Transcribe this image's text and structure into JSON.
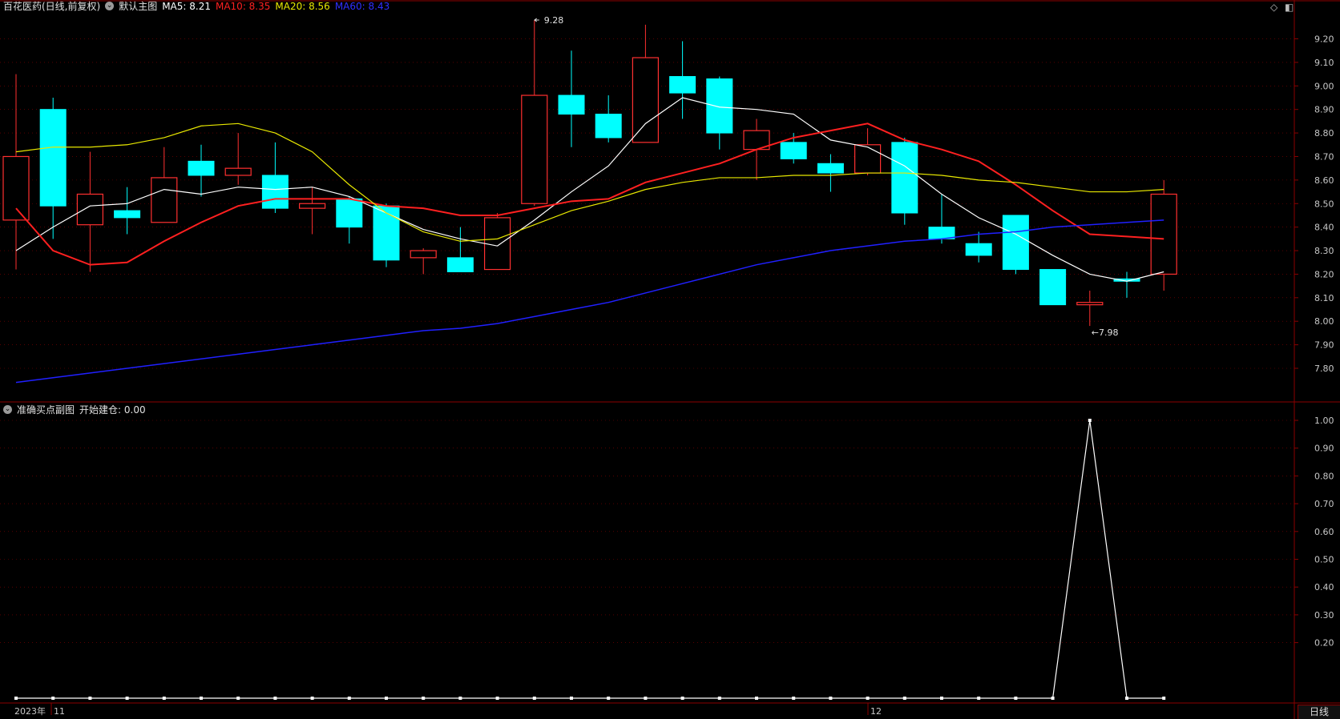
{
  "main_header": {
    "stock_name": "百花医药(日线,前复权)",
    "indicator_name": "默认主图",
    "ma5_label": "MA5: 8.21",
    "ma10_label": "MA10: 8.35",
    "ma20_label": "MA20: 8.56",
    "ma60_label": "MA60: 8.43"
  },
  "sub_header": {
    "indicator_name": "准确买点副图",
    "value_label": "开始建仓: 0.00"
  },
  "colors": {
    "up": "#ff3030",
    "down": "#00ffff",
    "ma5": "#ffffff",
    "ma10": "#ff2020",
    "ma20": "#e8e800",
    "ma60": "#2020ff",
    "grid": "#8b0000",
    "axis_text": "#c8c8c8"
  },
  "annotations": {
    "high_label": "9.28",
    "low_label": "7.98"
  },
  "x_axis": {
    "year_label": "2023年",
    "month_labels": [
      "11",
      "12"
    ]
  },
  "period_tab": "日线",
  "window_icons": [
    "diamond-icon",
    "panel-icon"
  ],
  "chart_data": [
    {
      "type": "candlestick",
      "title": "百花医药(日线,前复权)",
      "ylim": [
        7.7,
        9.28
      ],
      "y_ticks": [
        7.8,
        7.9,
        8.0,
        8.1,
        8.2,
        8.3,
        8.4,
        8.5,
        8.6,
        8.7,
        8.8,
        8.9,
        9.0,
        9.1,
        9.2
      ],
      "candles": [
        {
          "o": 8.43,
          "h": 9.05,
          "l": 8.22,
          "c": 8.7
        },
        {
          "o": 8.9,
          "h": 8.95,
          "l": 8.35,
          "c": 8.49
        },
        {
          "o": 8.41,
          "h": 8.72,
          "l": 8.21,
          "c": 8.54
        },
        {
          "o": 8.47,
          "h": 8.57,
          "l": 8.37,
          "c": 8.44
        },
        {
          "o": 8.42,
          "h": 8.74,
          "l": 8.42,
          "c": 8.61
        },
        {
          "o": 8.68,
          "h": 8.75,
          "l": 8.53,
          "c": 8.62
        },
        {
          "o": 8.62,
          "h": 8.8,
          "l": 8.58,
          "c": 8.65
        },
        {
          "o": 8.62,
          "h": 8.76,
          "l": 8.46,
          "c": 8.48
        },
        {
          "o": 8.48,
          "h": 8.57,
          "l": 8.37,
          "c": 8.5
        },
        {
          "o": 8.52,
          "h": 8.53,
          "l": 8.33,
          "c": 8.4
        },
        {
          "o": 8.49,
          "h": 8.5,
          "l": 8.23,
          "c": 8.26
        },
        {
          "o": 8.27,
          "h": 8.31,
          "l": 8.2,
          "c": 8.3
        },
        {
          "o": 8.27,
          "h": 8.4,
          "l": 8.21,
          "c": 8.21
        },
        {
          "o": 8.22,
          "h": 8.46,
          "l": 8.22,
          "c": 8.44
        },
        {
          "o": 8.5,
          "h": 9.28,
          "l": 8.49,
          "c": 8.96
        },
        {
          "o": 8.96,
          "h": 9.15,
          "l": 8.74,
          "c": 8.88
        },
        {
          "o": 8.88,
          "h": 8.96,
          "l": 8.76,
          "c": 8.78
        },
        {
          "o": 8.76,
          "h": 9.26,
          "l": 8.76,
          "c": 9.12
        },
        {
          "o": 9.04,
          "h": 9.19,
          "l": 8.86,
          "c": 8.97
        },
        {
          "o": 9.03,
          "h": 9.04,
          "l": 8.73,
          "c": 8.8
        },
        {
          "o": 8.73,
          "h": 8.86,
          "l": 8.6,
          "c": 8.81
        },
        {
          "o": 8.76,
          "h": 8.8,
          "l": 8.67,
          "c": 8.69
        },
        {
          "o": 8.67,
          "h": 8.71,
          "l": 8.55,
          "c": 8.63
        },
        {
          "o": 8.63,
          "h": 8.82,
          "l": 8.62,
          "c": 8.75
        },
        {
          "o": 8.76,
          "h": 8.78,
          "l": 8.41,
          "c": 8.46
        },
        {
          "o": 8.4,
          "h": 8.54,
          "l": 8.33,
          "c": 8.35
        },
        {
          "o": 8.33,
          "h": 8.38,
          "l": 8.25,
          "c": 8.28
        },
        {
          "o": 8.45,
          "h": 8.45,
          "l": 8.2,
          "c": 8.22
        },
        {
          "o": 8.22,
          "h": 8.22,
          "l": 8.07,
          "c": 8.07
        },
        {
          "o": 8.07,
          "h": 8.13,
          "l": 7.98,
          "c": 8.08
        },
        {
          "o": 8.18,
          "h": 8.21,
          "l": 8.1,
          "c": 8.17
        },
        {
          "o": 8.2,
          "h": 8.6,
          "l": 8.13,
          "c": 8.54
        }
      ],
      "series": [
        {
          "name": "MA5",
          "values": [
            8.3,
            8.4,
            8.49,
            8.5,
            8.56,
            8.54,
            8.57,
            8.56,
            8.57,
            8.53,
            8.46,
            8.39,
            8.35,
            8.32,
            8.43,
            8.55,
            8.66,
            8.84,
            8.95,
            8.91,
            8.9,
            8.88,
            8.77,
            8.74,
            8.66,
            8.54,
            8.44,
            8.37,
            8.28,
            8.2,
            8.17,
            8.21
          ]
        },
        {
          "name": "MA10",
          "values": [
            8.48,
            8.3,
            8.24,
            8.25,
            8.34,
            8.42,
            8.49,
            8.52,
            8.52,
            8.52,
            8.49,
            8.48,
            8.45,
            8.45,
            8.48,
            8.51,
            8.52,
            8.59,
            8.63,
            8.67,
            8.73,
            8.78,
            8.81,
            8.84,
            8.77,
            8.73,
            8.68,
            8.58,
            8.47,
            8.37,
            8.36,
            8.35
          ]
        },
        {
          "name": "MA20",
          "values": [
            8.72,
            8.74,
            8.74,
            8.75,
            8.78,
            8.83,
            8.84,
            8.8,
            8.72,
            8.58,
            8.46,
            8.38,
            8.34,
            8.35,
            8.41,
            8.47,
            8.51,
            8.56,
            8.59,
            8.61,
            8.61,
            8.62,
            8.62,
            8.63,
            8.63,
            8.62,
            8.6,
            8.59,
            8.57,
            8.55,
            8.55,
            8.56
          ]
        },
        {
          "name": "MA60",
          "values": [
            7.74,
            7.76,
            7.78,
            7.8,
            7.82,
            7.84,
            7.86,
            7.88,
            7.9,
            7.92,
            7.94,
            7.96,
            7.97,
            7.99,
            8.02,
            8.05,
            8.08,
            8.12,
            8.16,
            8.2,
            8.24,
            8.27,
            8.3,
            8.32,
            8.34,
            8.35,
            8.37,
            8.38,
            8.4,
            8.41,
            8.42,
            8.43
          ]
        }
      ]
    },
    {
      "type": "line",
      "title": "准确买点副图",
      "ylim": [
        0.0,
        1.05
      ],
      "y_ticks": [
        0.2,
        0.3,
        0.4,
        0.5,
        0.6,
        0.7,
        0.8,
        0.9,
        1.0
      ],
      "series": [
        {
          "name": "开始建仓",
          "values": [
            0,
            0,
            0,
            0,
            0,
            0,
            0,
            0,
            0,
            0,
            0,
            0,
            0,
            0,
            0,
            0,
            0,
            0,
            0,
            0,
            0,
            0,
            0,
            0,
            0,
            0,
            0,
            0,
            0,
            1,
            0,
            0
          ]
        }
      ]
    }
  ]
}
